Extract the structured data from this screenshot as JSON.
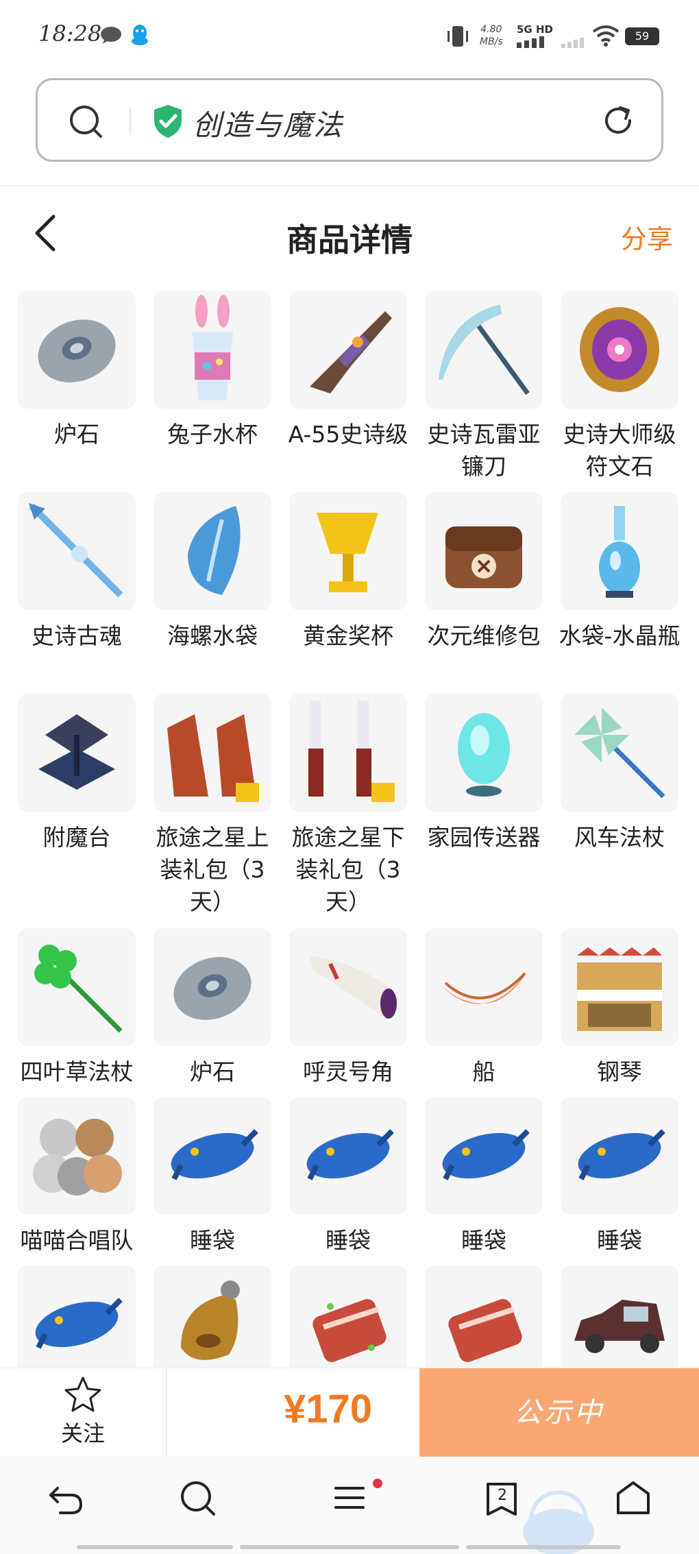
{
  "status_bar": {
    "time": "18:28",
    "speed_value": "4.80",
    "speed_unit": "MB/s",
    "network": "5G HD",
    "battery": "59"
  },
  "browser": {
    "site_title": "创造与魔法"
  },
  "header": {
    "title": "商品详情",
    "share": "分享"
  },
  "items": [
    {
      "label": "炉石",
      "icon": "stone-icon"
    },
    {
      "label": "兔子水杯",
      "icon": "bunny-cup-icon"
    },
    {
      "label": "A-55史诗级",
      "icon": "rifle-icon"
    },
    {
      "label": "史诗瓦雷亚镰刀",
      "icon": "scythe-icon"
    },
    {
      "label": "史诗大师级符文石",
      "icon": "rune-stone-icon"
    },
    {
      "label": "史诗古魂",
      "icon": "spear-icon"
    },
    {
      "label": "海螺水袋",
      "icon": "conch-icon"
    },
    {
      "label": "黄金奖杯",
      "icon": "trophy-icon"
    },
    {
      "label": "次元维修包",
      "icon": "repair-bag-icon"
    },
    {
      "label": "水袋-水晶瓶",
      "icon": "crystal-bottle-icon"
    },
    {
      "label": "附魔台",
      "icon": "enchant-table-icon"
    },
    {
      "label": "旅途之星上装礼包（3天）",
      "icon": "outfit-top-icon"
    },
    {
      "label": "旅途之星下装礼包（3天）",
      "icon": "outfit-bottom-icon"
    },
    {
      "label": "家园传送器",
      "icon": "teleporter-icon"
    },
    {
      "label": "风车法杖",
      "icon": "pinwheel-staff-icon"
    },
    {
      "label": "四叶草法杖",
      "icon": "clover-staff-icon"
    },
    {
      "label": "炉石",
      "icon": "stone-icon"
    },
    {
      "label": "呼灵号角",
      "icon": "horn-icon"
    },
    {
      "label": "船",
      "icon": "boat-icon"
    },
    {
      "label": "钢琴",
      "icon": "piano-icon"
    },
    {
      "label": "喵喵合唱队",
      "icon": "cats-icon"
    },
    {
      "label": "睡袋",
      "icon": "sleeping-bag-icon"
    },
    {
      "label": "睡袋",
      "icon": "sleeping-bag-icon"
    },
    {
      "label": "睡袋",
      "icon": "sleeping-bag-icon"
    },
    {
      "label": "睡袋",
      "icon": "sleeping-bag-icon"
    },
    {
      "label": "",
      "icon": "sleeping-bag-icon"
    },
    {
      "label": "",
      "icon": "gourd-icon"
    },
    {
      "label": "",
      "icon": "meat-icon"
    },
    {
      "label": "",
      "icon": "meat-icon"
    },
    {
      "label": "",
      "icon": "car-icon"
    }
  ],
  "action_bar": {
    "follow": "关注",
    "price": "¥170",
    "status_button": "公示中"
  },
  "nav": {
    "tab_count": "2"
  },
  "colors": {
    "accent": "#f07a24",
    "status_button_bg": "#f9a874",
    "shield": "#2bb673",
    "badge": "#e8344a"
  }
}
